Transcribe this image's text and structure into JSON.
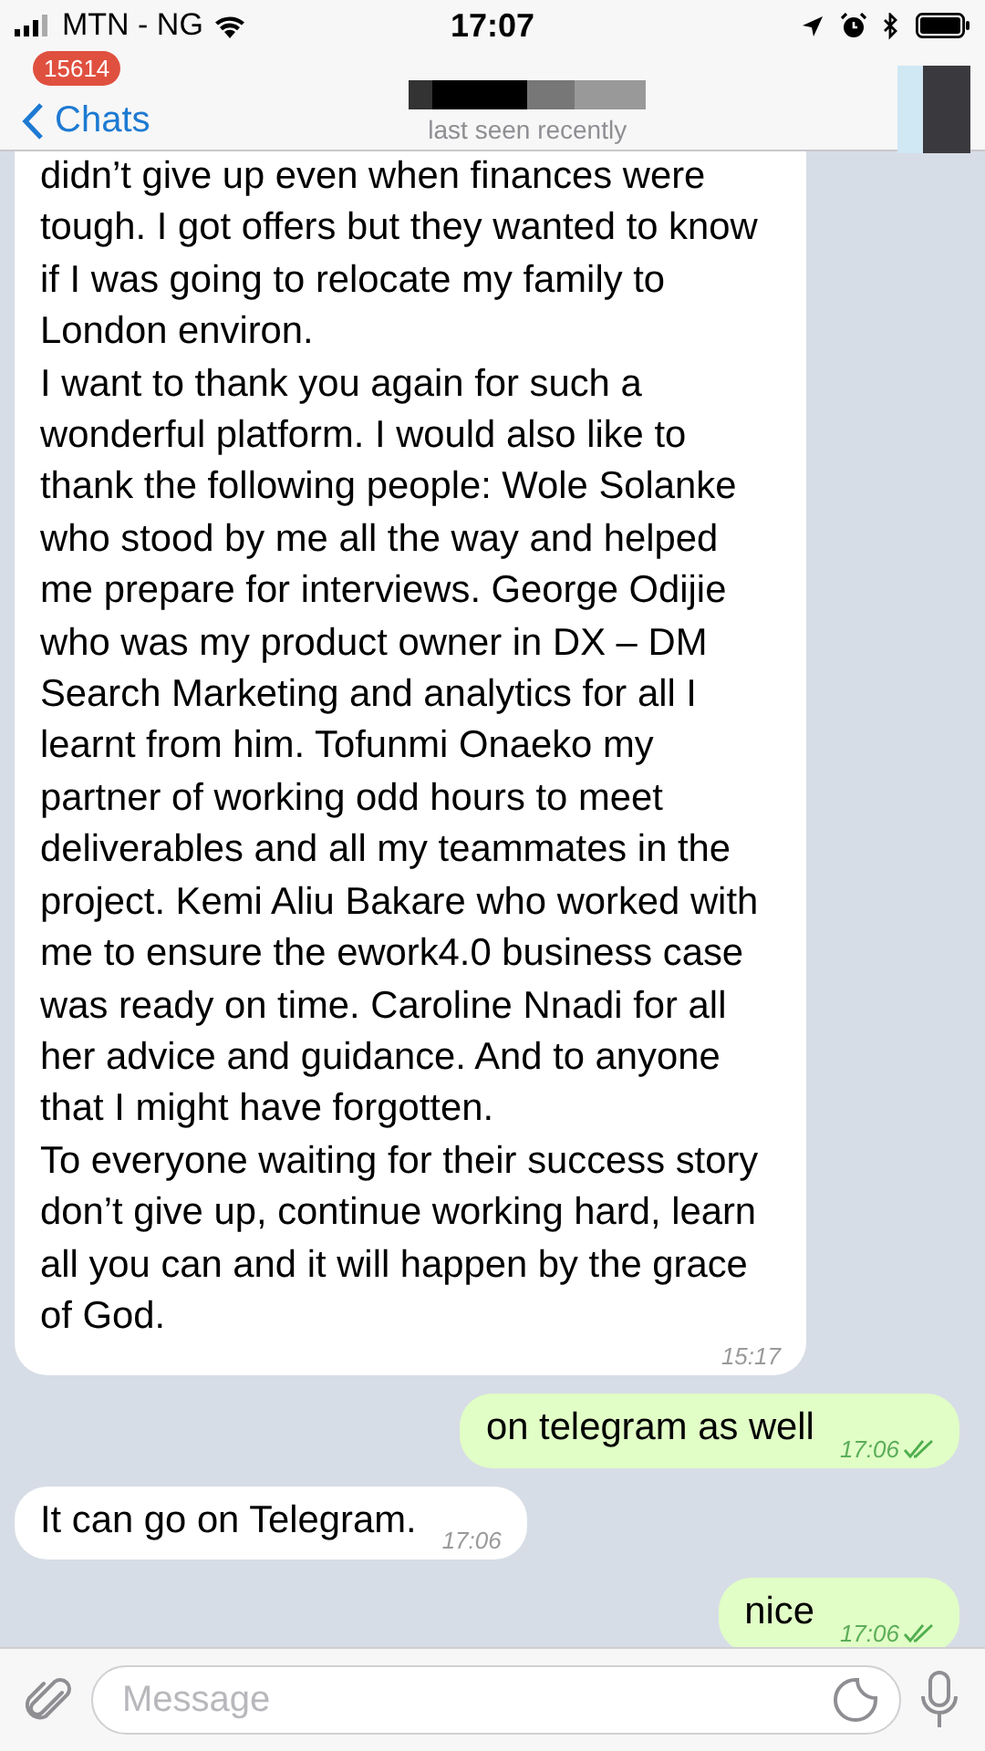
{
  "status_bar": {
    "carrier": "MTN - NG",
    "time": "17:07"
  },
  "nav_bar": {
    "back_label": "Chats",
    "unread_badge": "15614",
    "chat_status": "last seen recently"
  },
  "messages": [
    {
      "outgoing": false,
      "paragraphs": [
        "didn’t give up even when finances were tough. I got offers but they wanted to know if I was going to relocate my family to London environ.",
        "I want to thank you again for such a wonderful platform. I would also like to thank the following people: Wole Solanke who stood by me all the way and helped me prepare for interviews. George Odijie who was my product owner in DX – DM Search Marketing and analytics for all I learnt from him. Tofunmi Onaeko my partner of working odd hours to meet deliverables and all my teammates in the project. Kemi Aliu Bakare who worked with me to ensure the ework4.0 business case was ready on time. Caroline Nnadi for all her advice and guidance. And to anyone that I might have forgotten.",
        "To everyone waiting for their success story don’t give up, continue working hard, learn all you can and it will happen by the grace of God."
      ],
      "time": "15:17"
    },
    {
      "outgoing": true,
      "paragraphs": [
        "on telegram as well"
      ],
      "time": "17:06",
      "read": true
    },
    {
      "outgoing": false,
      "paragraphs": [
        "It can go on Telegram."
      ],
      "time": "17:06"
    },
    {
      "outgoing": true,
      "paragraphs": [
        "nice"
      ],
      "time": "17:06",
      "read": true
    }
  ],
  "input_bar": {
    "placeholder": "Message"
  }
}
